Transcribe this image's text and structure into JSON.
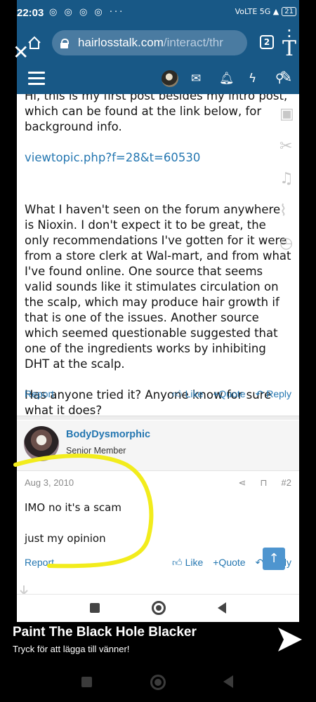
{
  "status_bar": {
    "time": "22:03",
    "notif_icons": "◎ ◎ ◎ ◎ ···",
    "right_indicators": "VoLTE 5G ▲",
    "battery": "21"
  },
  "browser": {
    "url_host": "hairlosstalk.com",
    "url_path": "/interact/thr",
    "tab_count": "2"
  },
  "thread": {
    "post1": {
      "cut_line": "Hi, this is my first post besides my intro post, which can be found at the link below, for background info.",
      "link_text": "viewtopic.php?f=28&t=60530",
      "paragraph2": "What I haven't seen on the forum anywhere is Nioxin. I don't expect it to be great, the only recommendations I've gotten for it were from a store clerk at Wal-mart, and from what I've found online. One source that seems valid sounds like it stimulates circulation on the scalp, which may produce hair growth if that is one of the issues. Another source which seemed questionable suggested that one of the ingredients works by inhibiting DHT at the scalp.",
      "paragraph3": "Has anyone tried it? Anyone know for sure what it does?"
    },
    "actions": {
      "report": "Report",
      "like": "Like",
      "quote": "+Quote",
      "reply": "Reply"
    },
    "post2": {
      "username": "BodyDysmorphic",
      "role": "Senior Member",
      "date": "Aug 3, 2010",
      "number": "#2",
      "line1": "IMO no it's a scam",
      "line2": "just my opinion"
    }
  },
  "snap_overlay": {
    "title": "Paint The Black Hole Blacker",
    "subtitle": "Tryck för att lägga till vänner!"
  },
  "colors": {
    "header_blue": "#185886",
    "link_blue": "#2577b1",
    "annotation_yellow": "#f2ec1c"
  }
}
